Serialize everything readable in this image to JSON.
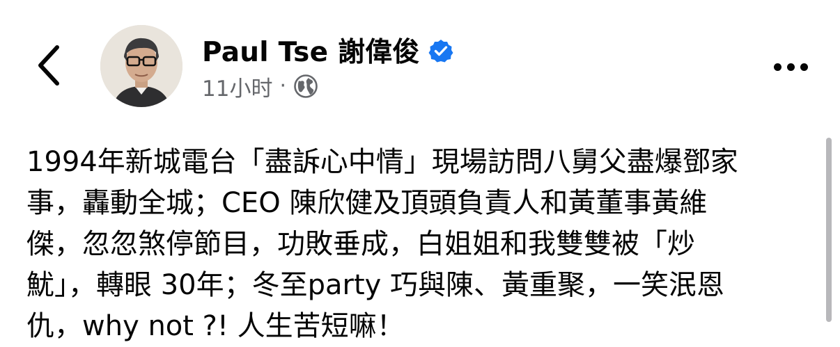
{
  "header": {
    "author_name": "Paul Tse 謝偉俊",
    "time_text": "11小时",
    "separator": "·",
    "icons": {
      "back": "chevron-left-icon",
      "verified": "verified-badge-icon",
      "audience": "globe-icon",
      "more": "more-horizontal-icon"
    }
  },
  "post": {
    "lines": [
      "1994年新城電台「盡訴心中情」現場訪問八舅父盡爆鄧家",
      "事，轟動全城；CEO 陳欣健及頂頭負責人和黃董事黃維",
      "傑，忽忽煞停節目，功敗垂成，白姐姐和我雙雙被「炒",
      "魷」，轉眼 30年；冬至party 巧與陳、黃重聚，一笑泯恩",
      "仇，why not ?! 人生苦短嘛！"
    ]
  },
  "colors": {
    "text_primary": "#050505",
    "text_secondary": "#65676b",
    "verified_blue": "#1877f2",
    "scrollbar": "#b8b8bb"
  }
}
